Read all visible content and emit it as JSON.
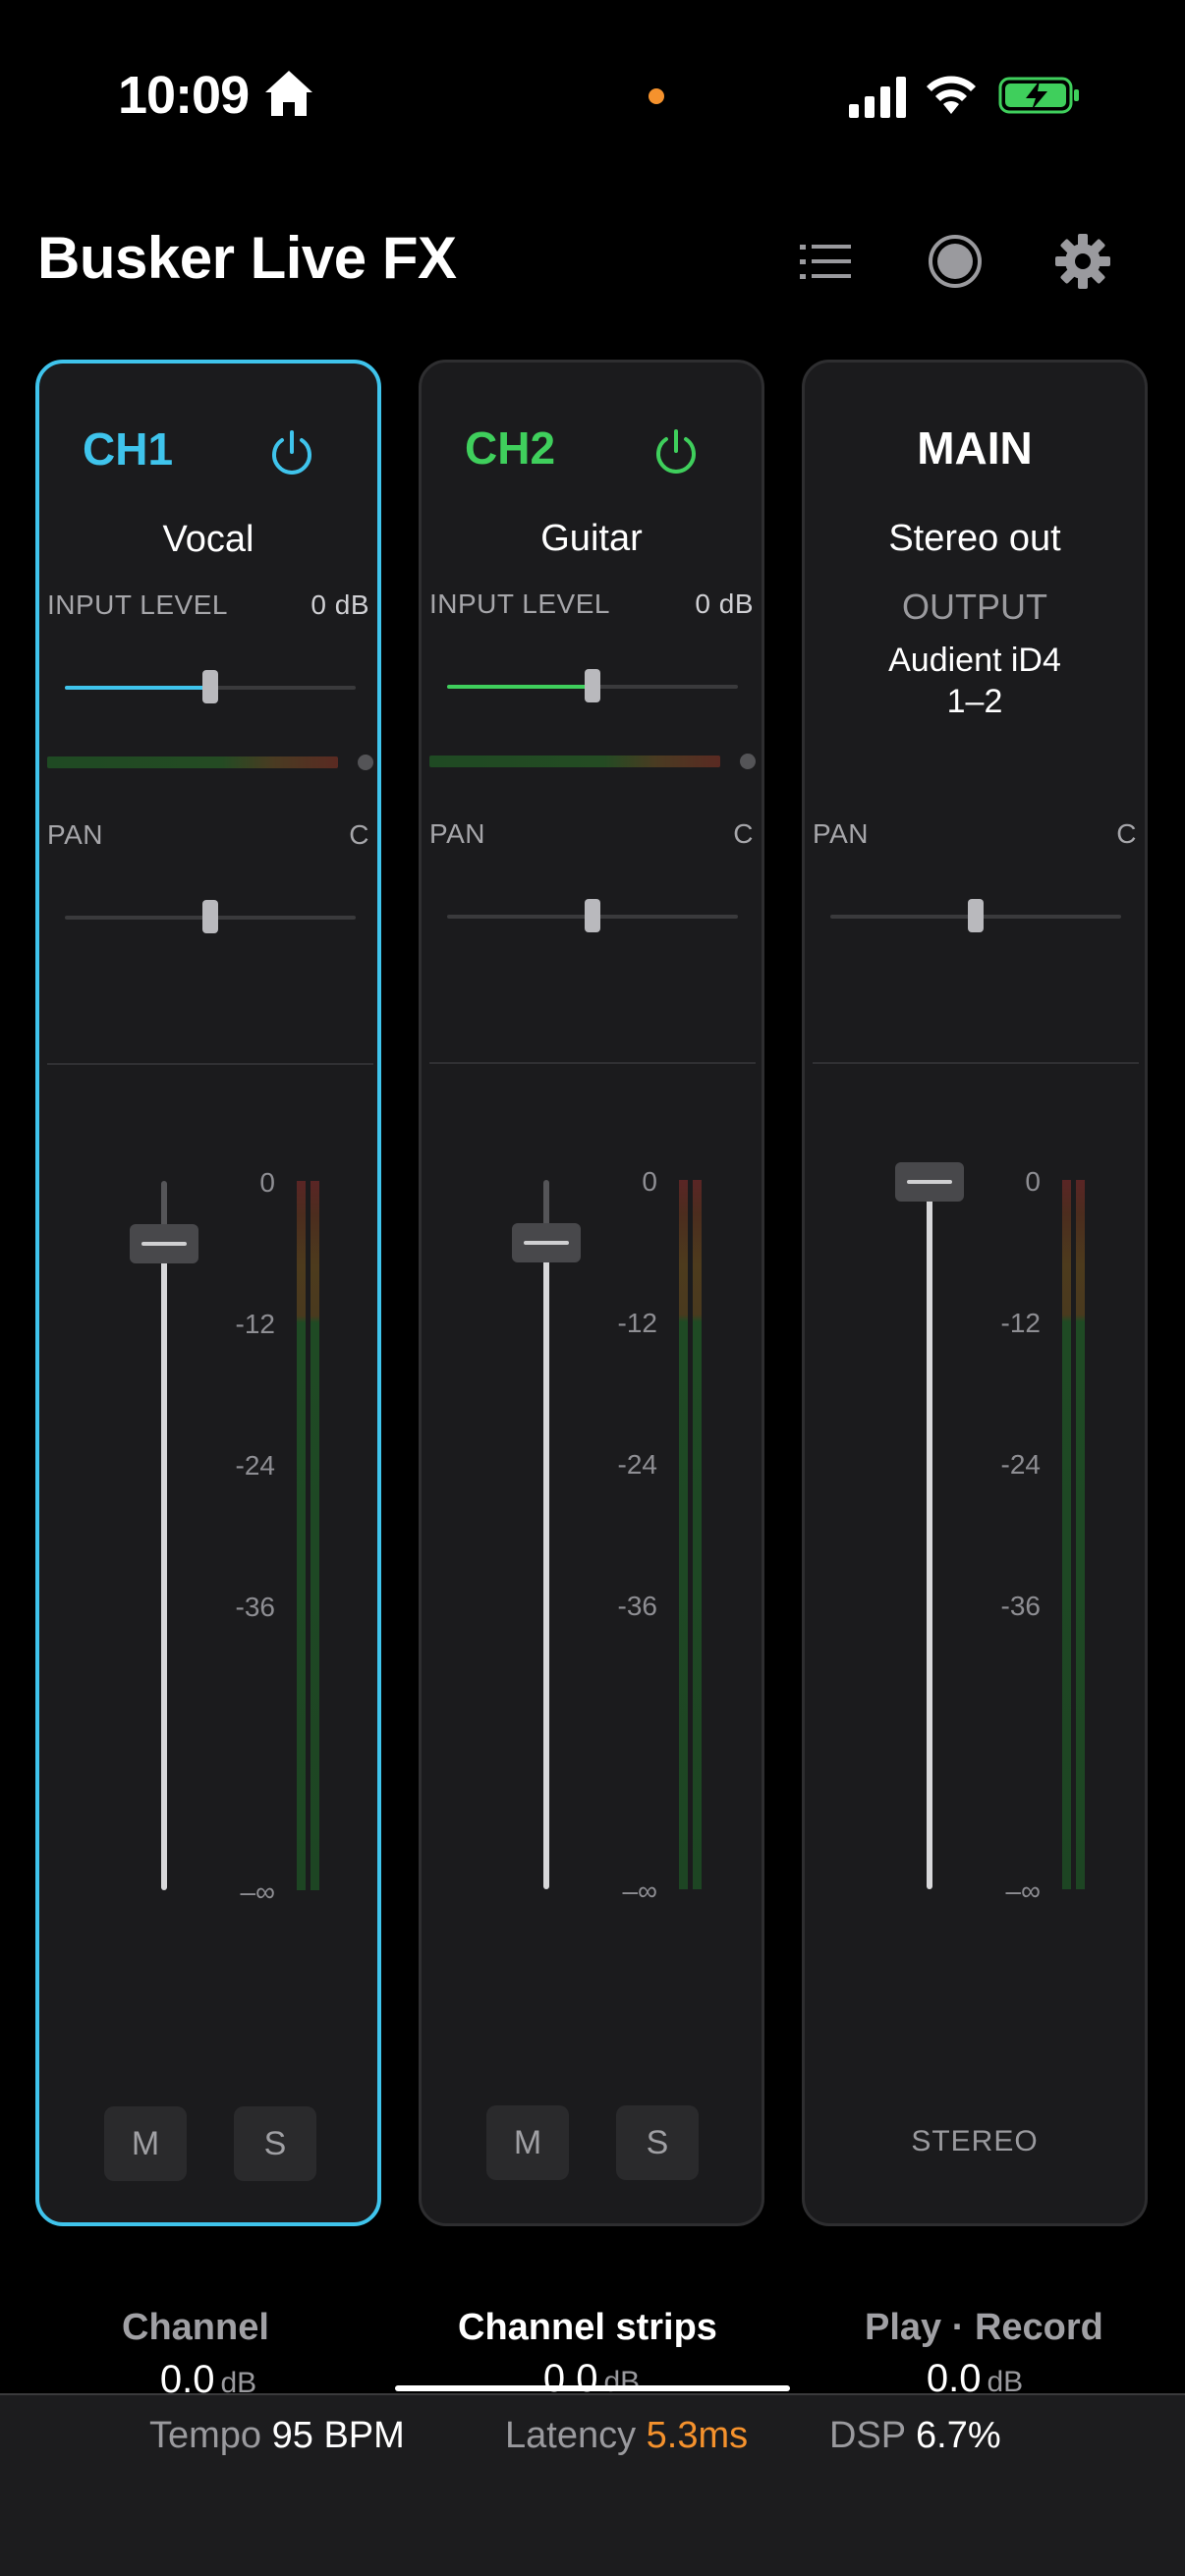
{
  "status": {
    "time": "10:09"
  },
  "app": {
    "title": "Busker Live FX"
  },
  "colors": {
    "ch1": "#3fc4ec",
    "ch2": "#3fcf5c",
    "latency": "#f5922d"
  },
  "channels": [
    {
      "id": "CH1",
      "name": "Vocal",
      "input_label": "INPUT LEVEL",
      "input_value": "0 dB",
      "input_level": 0.5,
      "pan_label": "PAN",
      "pan_value": "C",
      "gain": "0.0",
      "gain_unit": "dB",
      "mute": "M",
      "solo": "S"
    },
    {
      "id": "CH2",
      "name": "Guitar",
      "input_label": "INPUT LEVEL",
      "input_value": "0 dB",
      "input_level": 0.5,
      "pan_label": "PAN",
      "pan_value": "C",
      "gain": "0.0",
      "gain_unit": "dB",
      "mute": "M",
      "solo": "S"
    }
  ],
  "main": {
    "id": "MAIN",
    "name": "Stereo out",
    "output_label": "OUTPUT",
    "device_line1": "Audient iD4",
    "device_line2": "1–2",
    "pan_label": "PAN",
    "pan_value": "C",
    "gain": "0.0",
    "gain_unit": "dB",
    "mode": "STEREO"
  },
  "scale": [
    "0",
    "-12",
    "-24",
    "-36",
    "–∞"
  ],
  "tabs": [
    "Channel",
    "Channel strips",
    "Play · Record"
  ],
  "footer": {
    "tempo_label": "Tempo",
    "tempo_value": "95 BPM",
    "latency_label": "Latency",
    "latency_value": "5.3ms",
    "dsp_label": "DSP",
    "dsp_value": "6.7%"
  }
}
